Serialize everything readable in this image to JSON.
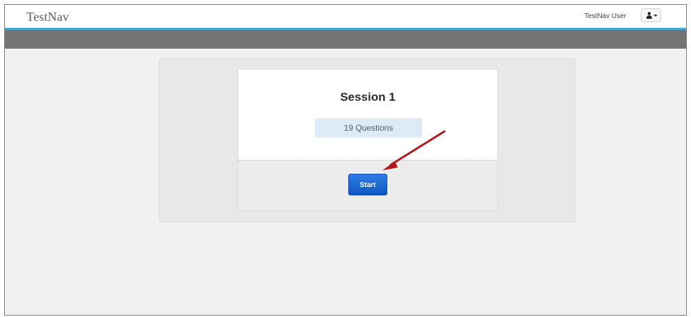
{
  "app": {
    "brand": "TestNav"
  },
  "user_menu": {
    "name": "TestNav User",
    "icon": "person-icon"
  },
  "session": {
    "title": "Session 1",
    "question_count": "19 Questions",
    "start_label": "Start"
  },
  "colors": {
    "accent_line": "#44a9d3",
    "toolbar_gray": "#747474",
    "badge_background": "#dcebf5",
    "start_button": "#1a63cf",
    "annotation_arrow": "#b3161b"
  }
}
